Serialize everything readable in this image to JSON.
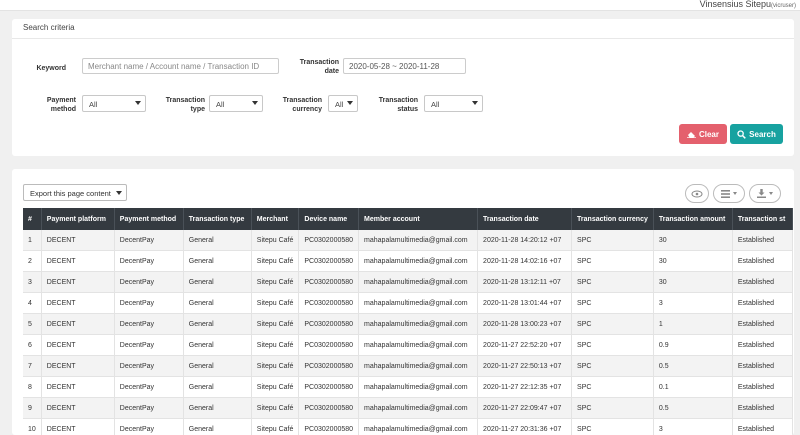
{
  "user": {
    "name": "Vinsensius Sitepu",
    "role": "(vicruser)"
  },
  "search": {
    "title": "Search criteria",
    "keyword_label": "Keyword",
    "keyword_placeholder": "Merchant name / Account name / Transaction ID",
    "date_label_1": "Transaction",
    "date_label_2": "date",
    "date_value": "2020-05-28 ~ 2020-11-28",
    "payment_method_label_1": "Payment",
    "payment_method_label_2": "method",
    "payment_method_value": "All",
    "transaction_type_label_1": "Transaction",
    "transaction_type_label_2": "type",
    "transaction_type_value": "All",
    "transaction_currency_label_1": "Transaction",
    "transaction_currency_label_2": "currency",
    "transaction_currency_value": "All",
    "transaction_status_label_1": "Transaction",
    "transaction_status_label_2": "status",
    "transaction_status_value": "All",
    "clear_label": "Clear",
    "search_label": "Search"
  },
  "list": {
    "export_label": "Export this page content",
    "columns": [
      "#",
      "Payment platform",
      "Payment method",
      "Transaction type",
      "Merchant",
      "Device name",
      "Member account",
      "Transaction date",
      "Transaction currency",
      "Transaction amount",
      "Transaction st"
    ],
    "rows": [
      [
        "1",
        "DECENT",
        "DecentPay",
        "General",
        "Sitepu Café",
        "PC0302000580",
        "mahapalamultimedia@gmail.com",
        "2020-11-28 14:20:12 +07",
        "SPC",
        "30",
        "Established"
      ],
      [
        "2",
        "DECENT",
        "DecentPay",
        "General",
        "Sitepu Café",
        "PC0302000580",
        "mahapalamultimedia@gmail.com",
        "2020-11-28 14:02:16 +07",
        "SPC",
        "30",
        "Established"
      ],
      [
        "3",
        "DECENT",
        "DecentPay",
        "General",
        "Sitepu Café",
        "PC0302000580",
        "mahapalamultimedia@gmail.com",
        "2020-11-28 13:12:11 +07",
        "SPC",
        "30",
        "Established"
      ],
      [
        "4",
        "DECENT",
        "DecentPay",
        "General",
        "Sitepu Café",
        "PC0302000580",
        "mahapalamultimedia@gmail.com",
        "2020-11-28 13:01:44 +07",
        "SPC",
        "3",
        "Established"
      ],
      [
        "5",
        "DECENT",
        "DecentPay",
        "General",
        "Sitepu Café",
        "PC0302000580",
        "mahapalamultimedia@gmail.com",
        "2020-11-28 13:00:23 +07",
        "SPC",
        "1",
        "Established"
      ],
      [
        "6",
        "DECENT",
        "DecentPay",
        "General",
        "Sitepu Café",
        "PC0302000580",
        "mahapalamultimedia@gmail.com",
        "2020-11-27 22:52:20 +07",
        "SPC",
        "0.9",
        "Established"
      ],
      [
        "7",
        "DECENT",
        "DecentPay",
        "General",
        "Sitepu Café",
        "PC0302000580",
        "mahapalamultimedia@gmail.com",
        "2020-11-27 22:50:13 +07",
        "SPC",
        "0.5",
        "Established"
      ],
      [
        "8",
        "DECENT",
        "DecentPay",
        "General",
        "Sitepu Café",
        "PC0302000580",
        "mahapalamultimedia@gmail.com",
        "2020-11-27 22:12:35 +07",
        "SPC",
        "0.1",
        "Established"
      ],
      [
        "9",
        "DECENT",
        "DecentPay",
        "General",
        "Sitepu Café",
        "PC0302000580",
        "mahapalamultimedia@gmail.com",
        "2020-11-27 22:09:47 +07",
        "SPC",
        "0.5",
        "Established"
      ],
      [
        "10",
        "DECENT",
        "DecentPay",
        "General",
        "Sitepu Café",
        "PC0302000580",
        "mahapalamultimedia@gmail.com",
        "2020-11-27 20:31:36 +07",
        "SPC",
        "3",
        "Established"
      ]
    ]
  },
  "colors": {
    "clear": "#e4606d",
    "search": "#17a2a0",
    "table_header": "#343a40"
  },
  "icons": [
    "eraser-icon",
    "search-icon",
    "eye-icon",
    "list-icon",
    "download-icon"
  ]
}
